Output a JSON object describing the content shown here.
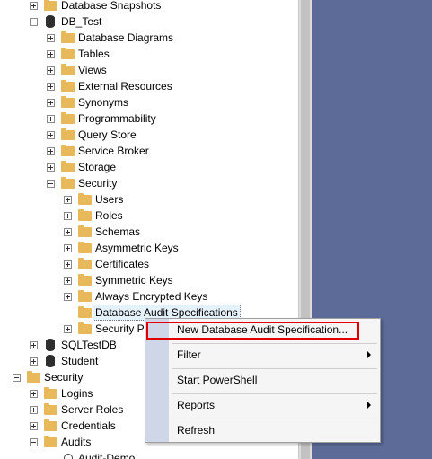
{
  "tree": {
    "db_snapshots": "Database Snapshots",
    "db_test": "DB_Test",
    "db_diagrams": "Database Diagrams",
    "tables": "Tables",
    "views": "Views",
    "external_resources": "External Resources",
    "synonyms": "Synonyms",
    "programmability": "Programmability",
    "query_store": "Query Store",
    "service_broker": "Service Broker",
    "storage": "Storage",
    "security": "Security",
    "users": "Users",
    "roles": "Roles",
    "schemas": "Schemas",
    "asymmetric_keys": "Asymmetric Keys",
    "certificates": "Certificates",
    "symmetric_keys": "Symmetric Keys",
    "always_encrypted_keys": "Always Encrypted Keys",
    "db_audit_specs": "Database Audit Specifications",
    "security_policies": "Security Po",
    "sqltestdb": "SQLTestDB",
    "student": "Student",
    "server_security": "Security",
    "logins": "Logins",
    "server_roles": "Server Roles",
    "credentials": "Credentials",
    "audits": "Audits",
    "audit_demo": "Audit-Demo"
  },
  "context_menu": {
    "new_spec": "New Database Audit Specification...",
    "filter": "Filter",
    "start_powershell": "Start PowerShell",
    "reports": "Reports",
    "refresh": "Refresh"
  },
  "colors": {
    "folder": "#e8b95a",
    "background_panel": "#5d6b99",
    "highlight_box": "#e00000",
    "menu_gutter": "#cfd6e8"
  }
}
